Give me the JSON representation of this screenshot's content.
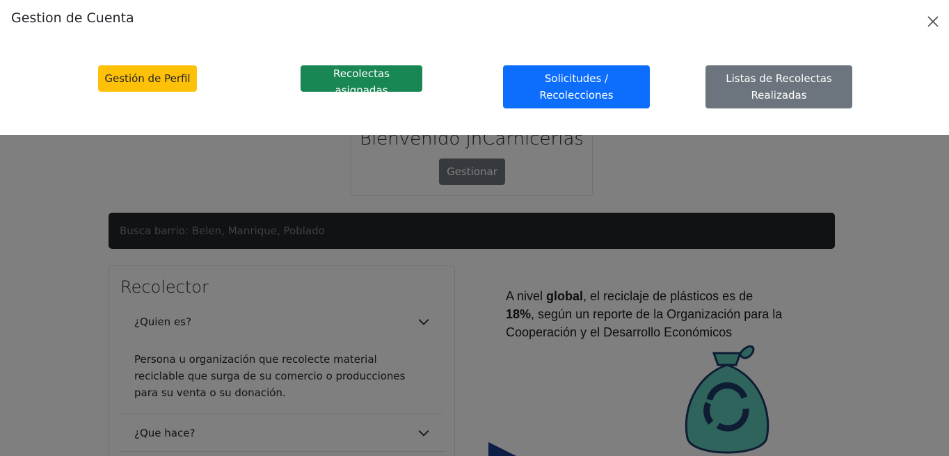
{
  "offcanvas": {
    "title": "Gestion de Cuenta",
    "buttons": {
      "perfil": "Gestión de Perfil",
      "asignadas": "Recolectas asignadas",
      "solicitudes": "Solicitudes / Recolecciones",
      "listas": "Listas de Recolectas Realizadas"
    },
    "close_icon": "close-icon"
  },
  "welcome": {
    "title": "Bienvenido jhCarnicerias",
    "manage_label": "Gestionar"
  },
  "search": {
    "placeholder": "Busca barrio: Belen, Manrique, Poblado"
  },
  "recolector": {
    "title": "Recolector",
    "items": [
      {
        "question": "¿Quien es?",
        "answer": "Persona u organización que recolecte material reciclable que surga de su comercio o producciones para su venta o su donación."
      },
      {
        "question": "¿Que hace?"
      }
    ]
  },
  "info": {
    "part1": "A nivel ",
    "bold1": "global",
    "part2": ", el reciclaje de plásticos es de ",
    "bold2": "18%",
    "part3": ", según un reporte de la Organización para la Cooperación y el Desarrollo Económicos"
  },
  "colors": {
    "warning": "#ffc107",
    "success": "#198754",
    "primary": "#0d6efd",
    "secondary": "#6c757d",
    "dark": "#212529"
  }
}
